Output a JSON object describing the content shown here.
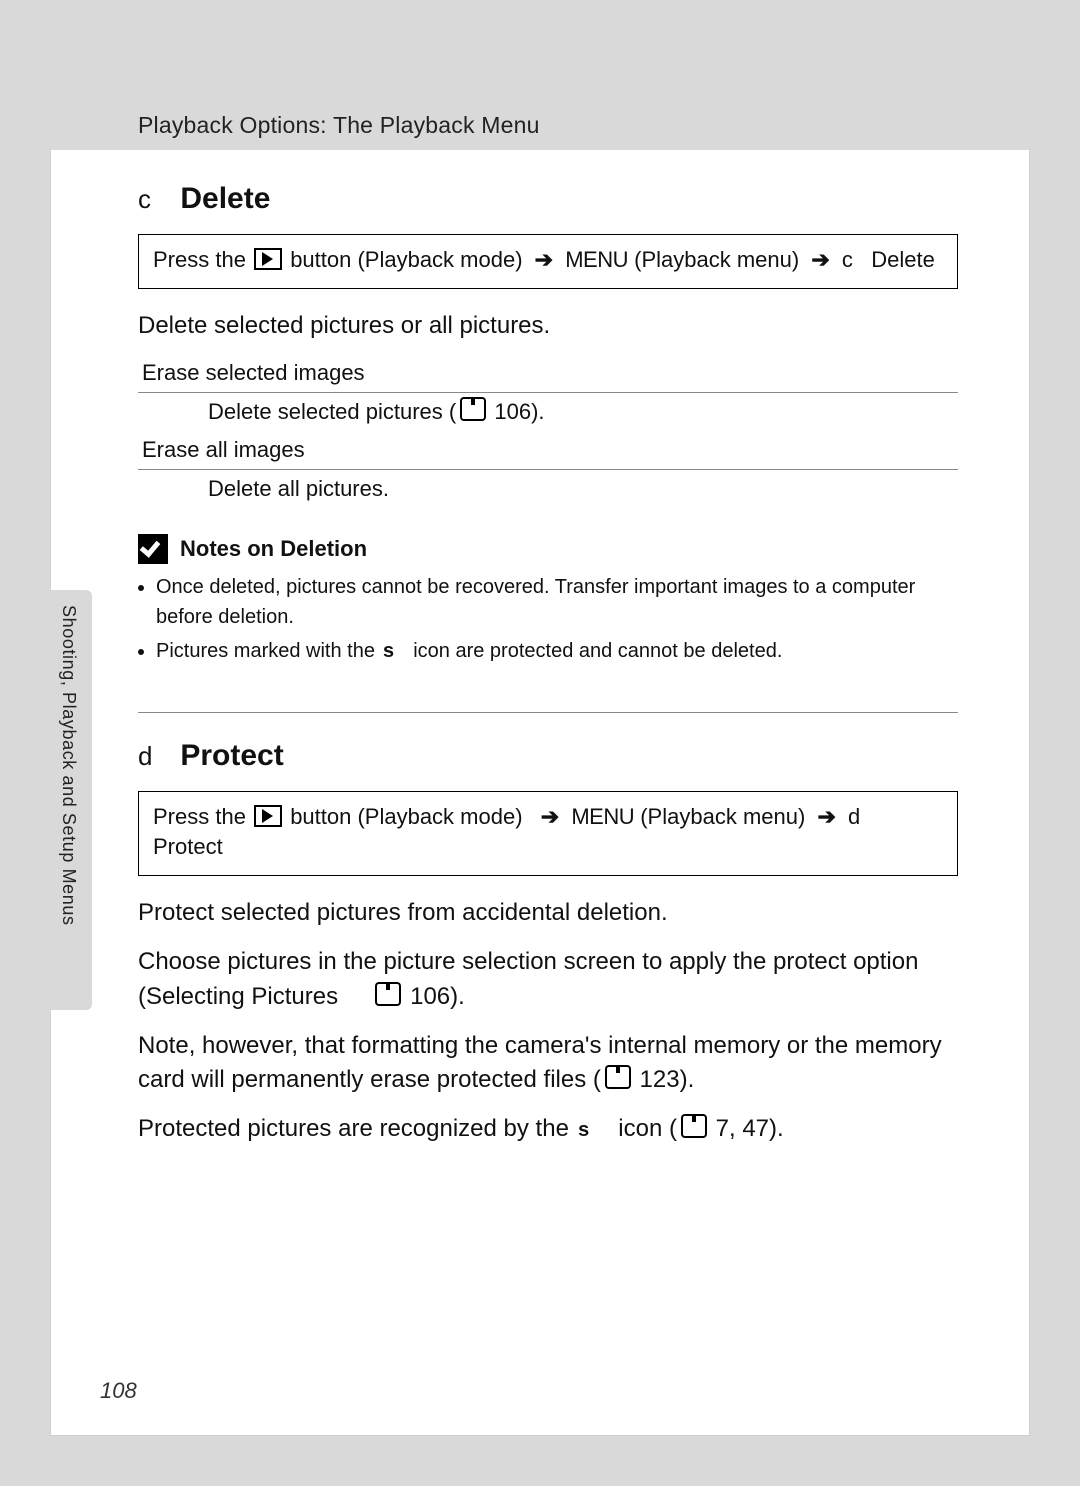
{
  "header": {
    "title": "Playback Options: The Playback Menu"
  },
  "sideTab": {
    "label": "Shooting, Playback and Setup Menus"
  },
  "section1": {
    "prefix": "c",
    "title": "Delete",
    "breadcrumb": {
      "press": "Press the",
      "btn": "button (Playback mode)",
      "menu": "MENU",
      "menu_after": "(Playback menu)",
      "tail_prefix": "c",
      "tail": "Delete"
    },
    "intro": "Delete selected pictures or all pictures.",
    "defs": [
      {
        "term": "Erase selected images",
        "desc_pre": "Delete selected pictures (",
        "desc_ref": "106",
        "desc_post": ")."
      },
      {
        "term": "Erase all images",
        "desc_pre": "Delete all pictures.",
        "desc_ref": "",
        "desc_post": ""
      }
    ],
    "notes": {
      "title": "Notes on Deletion",
      "items": [
        "Once deleted, pictures cannot be recovered. Transfer important images to a computer before deletion.",
        "Pictures marked with the s icon are protected and cannot be deleted."
      ]
    }
  },
  "section2": {
    "prefix": "d",
    "title": "Protect",
    "breadcrumb": {
      "press": "Press the",
      "btn": "button (Playback mode)",
      "menu": "MENU",
      "menu_after": "(Playback menu)",
      "tail_prefix": "d",
      "tail": "Protect"
    },
    "para1": "Protect selected pictures from accidental deletion.",
    "para2_pre": "Choose pictures in the picture selection screen to apply the protect option (Selecting Pictures ",
    "para2_ref": "106",
    "para2_post": ").",
    "para3_pre": "Note, however, that formatting the camera's internal memory or the memory card will permanently erase protected files (",
    "para3_ref": "123",
    "para3_post": ").",
    "para4_pre": "Protected pictures are recognized by the ",
    "para4_icon": "s",
    "para4_mid": " icon (",
    "para4_ref": "7, 47",
    "para4_post": ")."
  },
  "pageNumber": "108"
}
